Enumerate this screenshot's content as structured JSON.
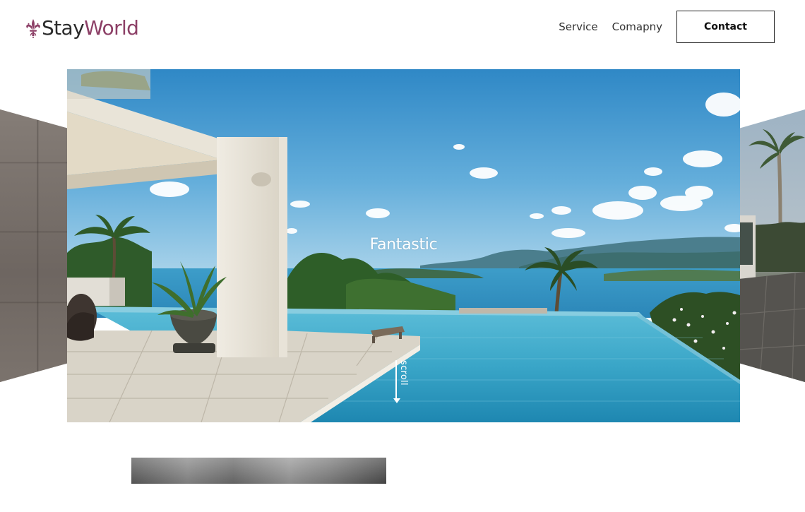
{
  "brand": {
    "name_part1": "Stay",
    "name_part2": "World",
    "mark_icon": "fleur-de-lis-icon",
    "colors": {
      "stay": "#2b2b2b",
      "world": "#8c3f66"
    }
  },
  "nav": {
    "items": [
      {
        "label": "Service"
      },
      {
        "label": "Comapny"
      }
    ],
    "contact_label": "Contact"
  },
  "hero": {
    "title": "Fantastic",
    "scroll_label": "scroll",
    "image": "infinity-pool-villa-ocean-view"
  },
  "side_slides": {
    "left_image": "stone-wall-interior",
    "right_image": "palm-terrace"
  },
  "preview_image": "next-section-thumbnail"
}
